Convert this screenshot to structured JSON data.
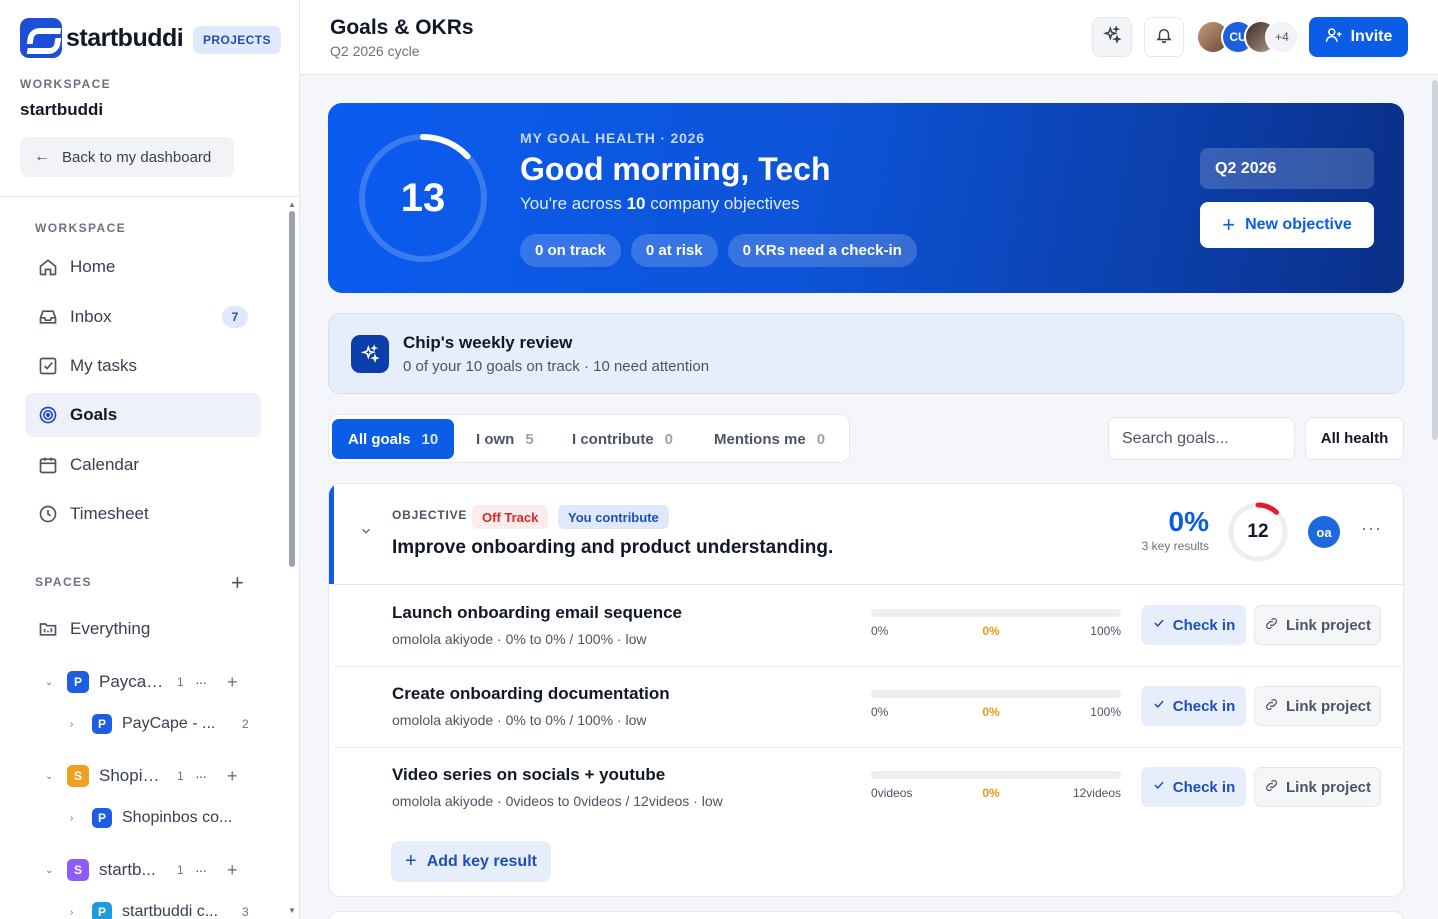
{
  "brand": {
    "name": "startbuddi",
    "badge": "PROJECTS"
  },
  "workspace": {
    "label": "WORKSPACE",
    "name": "startbuddi",
    "back_label": "Back to my dashboard"
  },
  "nav": {
    "section_label": "WORKSPACE",
    "items": [
      {
        "label": "Home",
        "icon": "home-icon"
      },
      {
        "label": "Inbox",
        "icon": "inbox-icon",
        "count": "7"
      },
      {
        "label": "My tasks",
        "icon": "checkbox-icon"
      },
      {
        "label": "Goals",
        "icon": "target-icon",
        "active": true
      },
      {
        "label": "Calendar",
        "icon": "calendar-icon"
      },
      {
        "label": "Timesheet",
        "icon": "clock-icon"
      }
    ]
  },
  "spaces": {
    "label": "SPACES",
    "everything_label": "Everything",
    "items": [
      {
        "initial": "P",
        "name": "Paycape",
        "count": "1",
        "color": "#1d5fe0",
        "sub": {
          "initial": "P",
          "name": "PayCape - ...",
          "count": "2",
          "color": "#1d5fe0"
        }
      },
      {
        "initial": "S",
        "name": "Shopin...",
        "count": "1",
        "color": "#f0a020",
        "sub": {
          "initial": "P",
          "name": "Shopinbos co...",
          "count": "",
          "color": "#1d5fe0"
        }
      },
      {
        "initial": "S",
        "name": "startb...",
        "count": "1",
        "color": "#8b5cf6",
        "sub": {
          "initial": "P",
          "name": "startbuddi c...",
          "count": "3",
          "color": "#1d9be0"
        }
      }
    ]
  },
  "header": {
    "title": "Goals & OKRs",
    "subtitle": "Q2 2026 cycle",
    "avatar_initials": "CU",
    "avatar_more": "+4",
    "invite_label": "Invite"
  },
  "hero": {
    "score": "13",
    "score_fraction": 0.13,
    "kicker": "MY GOAL HEALTH · 2026",
    "greeting": "Good morning, Tech",
    "summary_prefix": "You're across ",
    "summary_count": "10",
    "summary_suffix": " company objectives",
    "chips": [
      "0 on track",
      "0 at risk",
      "0 KRs need a check-in"
    ],
    "cycle": "Q2 2026",
    "new_objective_label": "New objective"
  },
  "review": {
    "title": "Chip's weekly review",
    "summary": "0 of your 10 goals on track · 10 need attention"
  },
  "tabs": [
    {
      "label": "All goals",
      "count": "10",
      "active": true
    },
    {
      "label": "I own",
      "count": "5"
    },
    {
      "label": "I contribute",
      "count": "0"
    },
    {
      "label": "Mentions me",
      "count": "0"
    }
  ],
  "filters": {
    "search_placeholder": "Search goals...",
    "health_label": "All health"
  },
  "objective": {
    "kicker": "OBJECTIVE",
    "status_badge": "Off Track",
    "role_badge": "You contribute",
    "title": "Improve onboarding and product understanding.",
    "progress": "0%",
    "key_results_label": "3 key results",
    "health_score": "12",
    "health_fraction": 0.12,
    "owner_initials": "oa",
    "more_label": "···",
    "key_results": [
      {
        "title": "Launch onboarding email sequence",
        "meta": "omolola akiyode · 0% to 0% / 100% · low",
        "from": "0%",
        "current": "0%",
        "to": "100%",
        "progress": 0
      },
      {
        "title": "Create onboarding documentation",
        "meta": "omolola akiyode · 0% to 0% / 100% · low",
        "from": "0%",
        "current": "0%",
        "to": "100%",
        "progress": 0
      },
      {
        "title": "Video series on socials + youtube",
        "meta": "omolola akiyode · 0videos to 0videos / 12videos · low",
        "from": "0videos",
        "current": "0%",
        "to": "12videos",
        "progress": 0
      }
    ],
    "checkin_label": "Check in",
    "link_label": "Link project",
    "add_kr_label": "Add key result"
  },
  "colors": {
    "primary": "#0b5ce6",
    "danger": "#dc2626",
    "warning": "#e59a14"
  }
}
